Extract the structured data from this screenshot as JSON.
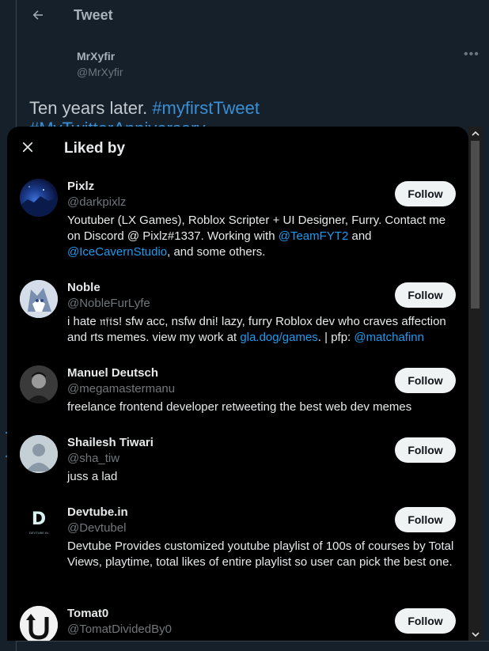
{
  "background": {
    "title": "Tweet",
    "author_name": "MrXyfir",
    "author_handle": "@MrXyfir",
    "tweet_text": "Ten years later.",
    "tweet_hashtag": "#myfirstTweet",
    "tweet_line2": "#MyTwitterAnniversary"
  },
  "modal": {
    "title": "Liked by"
  },
  "users": [
    {
      "name": "Pixlz",
      "handle": "@darkpixlz",
      "bio_parts": [
        "Youtuber (LX Games), Roblox Scripter + UI Designer, Furry. Contact me on Discord @ Pixlz#1337. Working with ",
        "@TeamFYT2",
        " and ",
        "@IceCavernStudio",
        ", and some others."
      ],
      "follow_label": "Follow"
    },
    {
      "name": "Noble",
      "handle": "@NobleFurLyfe",
      "bio_parts": [
        "i hate 𝔫𝔣𝔱s! sfw acc, nsfw dni! lazy, furry Roblox dev who craves affection and rts memes. view my work at ",
        "gla.dog/games",
        ". | pfp: ",
        "@matchafinn"
      ],
      "follow_label": "Follow"
    },
    {
      "name": "Manuel Deutsch",
      "handle": "@megamastermanu",
      "bio": "freelance frontend developer retweeting the best web dev memes",
      "follow_label": "Follow"
    },
    {
      "name": "Shailesh Tiwari",
      "handle": "@sha_tiw",
      "bio": "juss a lad",
      "follow_label": "Follow"
    },
    {
      "name": "Devtube.in",
      "handle": "@Devtubel",
      "bio": "Devtube Provides customized youtube playlist of 100s of courses by Total Views, playtime, total likes of entire playlist so user can pick the best one.",
      "avatar_letter": "D",
      "avatar_caption": "DEVTUBE.IN",
      "follow_label": "Follow"
    },
    {
      "name": "Tomat0",
      "handle": "@TomatDividedBy0",
      "follow_label": "Follow"
    }
  ],
  "colors": {
    "link": "#1d9bf0",
    "modal_bg": "#000000",
    "page_bg": "#15202b",
    "follow_bg": "#eff3f4"
  },
  "icons": {
    "back": "back-arrow-icon",
    "more": "more-icon",
    "close": "close-icon",
    "scroll_up": "scroll-up-arrow-icon",
    "scroll_down": "scroll-down-arrow-icon"
  }
}
